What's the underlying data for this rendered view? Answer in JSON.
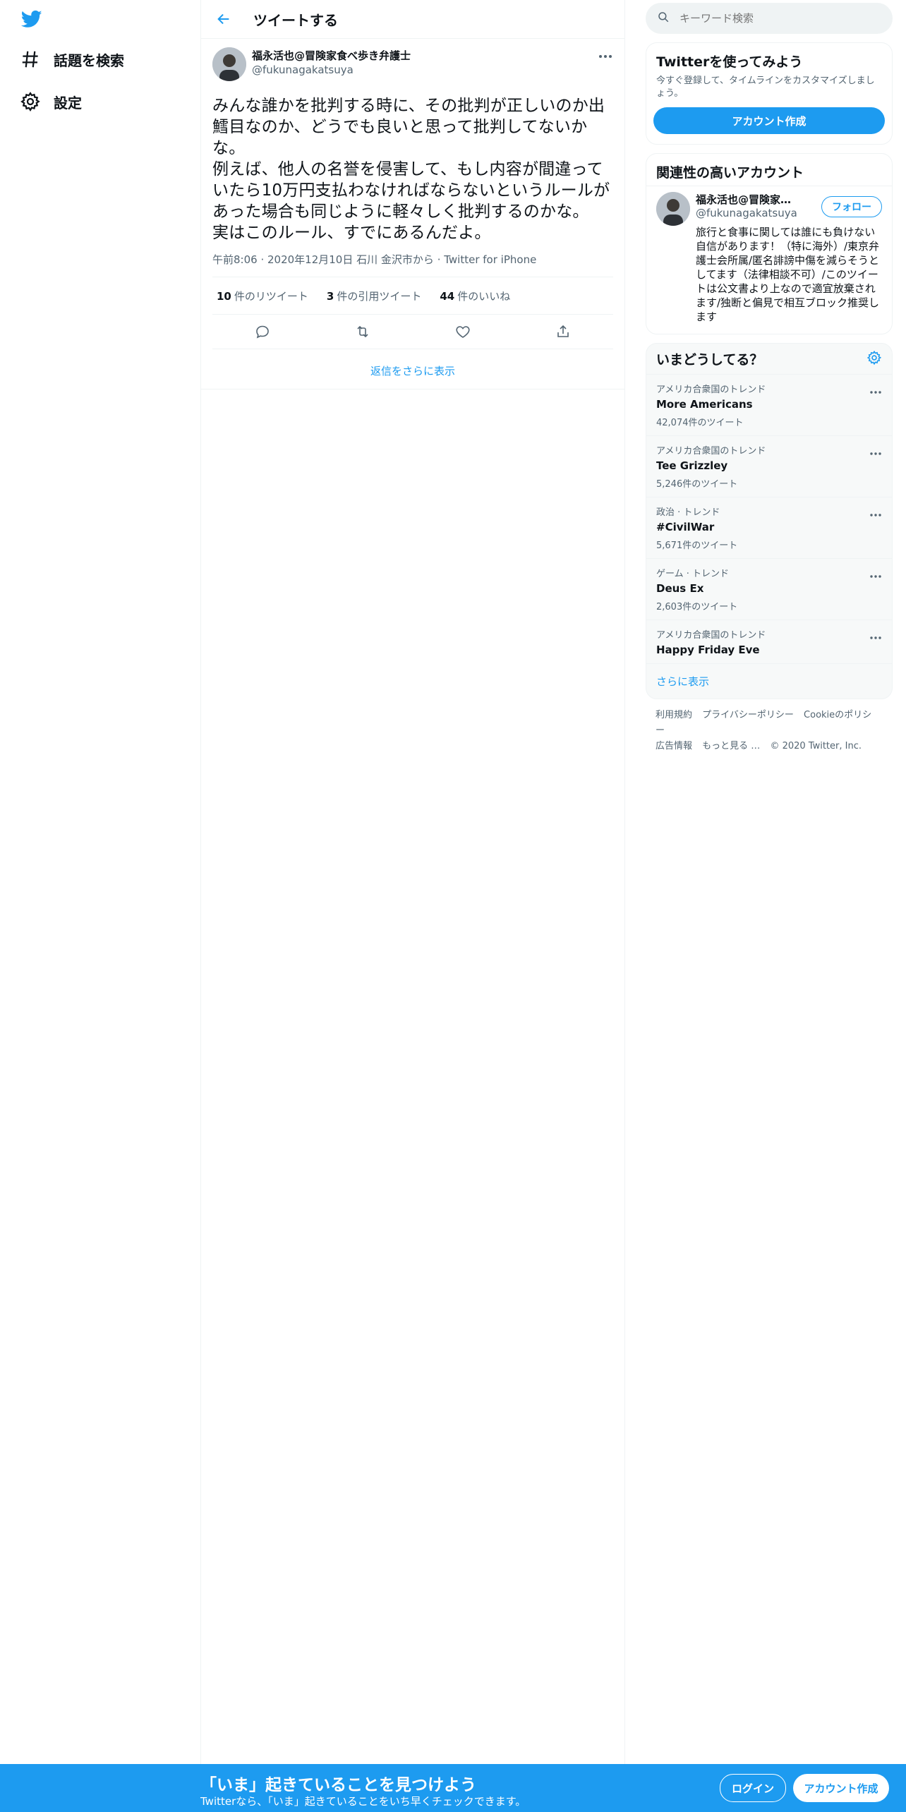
{
  "nav": {
    "items": [
      {
        "label": "話題を検索",
        "icon": "hashtag-icon"
      },
      {
        "label": "設定",
        "icon": "gear-icon"
      }
    ]
  },
  "header": {
    "title": "ツイートする"
  },
  "tweet": {
    "author_name": "福永活也@冒険家食べ歩き弁護士",
    "author_handle": "@fukunagakatsuya",
    "text": "みんな誰かを批判する時に、その批判が正しいのか出鱈目なのか、どうでも良いと思って批判してないかな。\n例えば、他人の名誉を侵害して、もし内容が間違っていたら10万円支払わなければならないというルールがあった場合も同じように軽々しく批判するのかな。\n実はこのルール、すでにあるんだよ。",
    "time": "午前8:06",
    "date": "2020年12月10日",
    "location": "石川 金沢市から",
    "source": "Twitter for iPhone",
    "retweets_count": "10",
    "retweets_label": "件のリツイート",
    "quotes_count": "3",
    "quotes_label": "件の引用ツイート",
    "likes_count": "44",
    "likes_label": "件のいいね"
  },
  "more_replies": "返信をさらに表示",
  "search": {
    "placeholder": "キーワード検索"
  },
  "signup_card": {
    "title": "Twitterを使ってみよう",
    "subtitle": "今すぐ登録して、タイムラインをカスタマイズしましょう。",
    "button": "アカウント作成"
  },
  "related": {
    "title": "関連性の高いアカウント",
    "name": "福永活也@冒険家食べ歩き弁護士",
    "handle": "@fukunagakatsuya",
    "follow": "フォロー",
    "bio": "旅行と食事に関しては誰にも負けない自信があります！（特に海外）/東京弁護士会所属/匿名誹謗中傷を減らそうとしてます（法律相談不可）/このツイートは公文書より上なので適宜放棄されます/独断と偏見で相互ブロック推奨します"
  },
  "trends": {
    "title": "いまどうしてる？",
    "items": [
      {
        "context": "アメリカ合衆国のトレンド",
        "name": "More Americans",
        "count": "42,074件のツイート"
      },
      {
        "context": "アメリカ合衆国のトレンド",
        "name": "Tee Grizzley",
        "count": "5,246件のツイート"
      },
      {
        "context": "政治 · トレンド",
        "name": "#CivilWar",
        "count": "5,671件のツイート"
      },
      {
        "context": "ゲーム · トレンド",
        "name": "Deus Ex",
        "count": "2,603件のツイート"
      },
      {
        "context": "アメリカ合衆国のトレンド",
        "name": "Happy Friday Eve",
        "count": ""
      }
    ],
    "show_more": "さらに表示"
  },
  "footer": {
    "terms": "利用規約",
    "privacy": "プライバシーポリシー",
    "cookie": "Cookieのポリシー",
    "ads": "広告情報",
    "more": "もっと見る …",
    "copyright": "© 2020 Twitter, Inc."
  },
  "bottom_bar": {
    "title": "「いま」起きていることを見つけよう",
    "subtitle": "Twitterなら、「いま」起きていることをいち早くチェックできます。",
    "login": "ログイン",
    "signup": "アカウント作成"
  },
  "colors": {
    "accent": "#1d9bf0",
    "text": "#0f1419",
    "muted": "#536471"
  }
}
